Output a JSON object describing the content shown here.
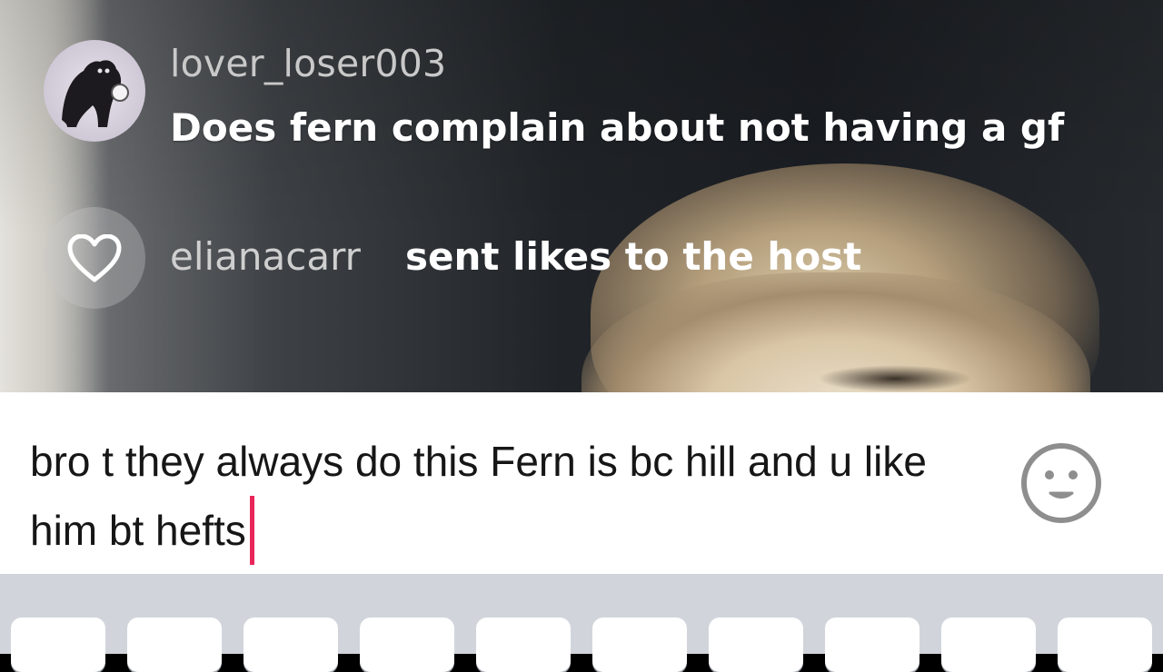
{
  "comment": {
    "username": "lover_loser003",
    "text": "Does fern complain about not having a gf"
  },
  "like_event": {
    "username": "elianacarr",
    "text": "sent likes to the host"
  },
  "input": {
    "text": "bro t they always do this Fern is bc hill and u like him bt hefts",
    "caret_color": "#e8265a"
  },
  "icons": {
    "like": "heart-icon",
    "emoji": "smiley-icon"
  },
  "keyboard": {
    "keys": [
      "",
      "",
      "",
      "",
      "",
      "",
      "",
      "",
      "",
      ""
    ]
  },
  "colors": {
    "username": "#c9c9c9",
    "comment_text": "#ffffff",
    "keyboard_bg": "#d1d5db"
  }
}
